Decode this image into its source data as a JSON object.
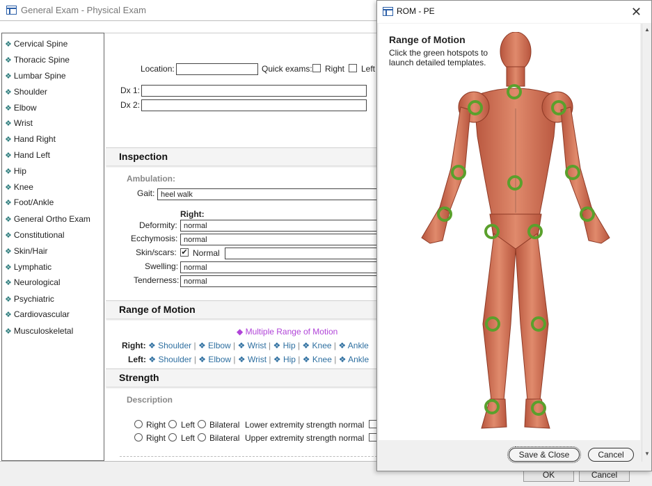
{
  "window": {
    "title": "General Exam - Physical Exam"
  },
  "sidebar": {
    "items": [
      {
        "label": "Cervical Spine"
      },
      {
        "label": "Thoracic Spine"
      },
      {
        "label": "Lumbar Spine"
      },
      {
        "label": "Shoulder"
      },
      {
        "label": "Elbow"
      },
      {
        "label": "Wrist"
      },
      {
        "label": "Hand Right"
      },
      {
        "label": "Hand Left"
      },
      {
        "label": "Hip"
      },
      {
        "label": "Knee"
      },
      {
        "label": "Foot/Ankle"
      },
      {
        "label": "General Ortho Exam"
      },
      {
        "label": "Constitutional"
      },
      {
        "label": "Skin/Hair"
      },
      {
        "label": "Lymphatic"
      },
      {
        "label": "Neurological"
      },
      {
        "label": "Psychiatric"
      },
      {
        "label": "Cardiovascular"
      },
      {
        "label": "Musculoskeletal"
      }
    ]
  },
  "header": {
    "location_label": "Location:",
    "location_value": "",
    "quick_exams_label": "Quick exams:",
    "quick_right": "Right",
    "quick_left": "Left",
    "dx1_label": "Dx 1:",
    "dx2_label": "Dx 2:"
  },
  "inspection": {
    "title": "Inspection",
    "ambulation": "Ambulation:",
    "gait_label": "Gait:",
    "gait_value": "heel walk",
    "right_header": "Right:",
    "deformity_label": "Deformity:",
    "deformity_value": "normal",
    "ecchymosis_label": "Ecchymosis:",
    "ecchymosis_value": "normal",
    "skin_label": "Skin/scars:",
    "skin_check": "Normal",
    "swelling_label": "Swelling:",
    "swelling_value": "normal",
    "tenderness_label": "Tenderness:",
    "tenderness_value": "normal"
  },
  "rom": {
    "title": "Range of Motion",
    "multiple_link": "Multiple Range of Motion",
    "right_label": "Right:",
    "left_label": "Left:",
    "links": [
      "Shoulder",
      "Elbow",
      "Wrist",
      "Hip",
      "Knee",
      "Ankle"
    ]
  },
  "strength": {
    "title": "Strength",
    "description": "Description",
    "opt_right": "Right",
    "opt_left": "Left",
    "opt_bilateral": "Bilateral",
    "lower_label": "Lower extremity strength normal",
    "upper_label": "Upper extremity strength normal"
  },
  "dialog": {
    "title": "ROM - PE",
    "heading": "Range of Motion",
    "instr1": "Click the green hotspots to",
    "instr2": "launch detailed templates.",
    "save_label": "Save & Close",
    "cancel_label": "Cancel"
  },
  "bottom": {
    "ok_label": "OK",
    "cancel_label": "Cancel"
  },
  "colors": {
    "link": "#2e6fa0",
    "accent": "#b044d8",
    "hotspot": "#5aa02c",
    "bullet": "#2e7d7d"
  }
}
